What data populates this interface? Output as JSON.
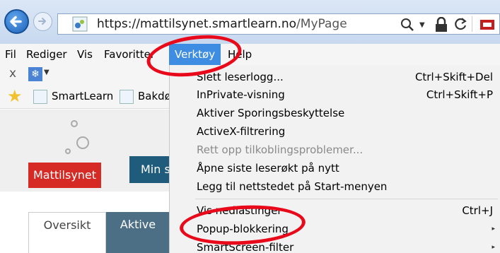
{
  "browser": {
    "url_scheme": "https://",
    "url_host": "mattilsynet.smartlearn.no",
    "url_path": "/MyPage"
  },
  "menubar": {
    "items": [
      "Fil",
      "Rediger",
      "Vis",
      "Favoritter",
      "Verktøy",
      "Help"
    ],
    "active": "Verktøy"
  },
  "favorites": {
    "items": [
      "SmartLearn",
      "Bakdø"
    ]
  },
  "page": {
    "logo_text": "Mattilsynet",
    "button_label": "Min s",
    "tabs": [
      "Oversikt",
      "Aktive"
    ]
  },
  "tools_menu": {
    "items": [
      {
        "label": "Slett leserlogg...",
        "shortcut": "Ctrl+Skift+Del"
      },
      {
        "label": "InPrivate-visning",
        "shortcut": "Ctrl+Skift+P"
      },
      {
        "label": "Aktiver Sporingsbeskyttelse",
        "shortcut": ""
      },
      {
        "label": "ActiveX-filtrering",
        "shortcut": ""
      },
      {
        "label": "Rett opp tilkoblingsproblemer...",
        "shortcut": "",
        "disabled": true
      },
      {
        "label": "Åpne siste leserøkt på nytt",
        "shortcut": ""
      },
      {
        "label": "Legg til nettstedet på Start-menyen",
        "shortcut": ""
      },
      {
        "label": "Vis nedlastinger",
        "shortcut": "Ctrl+J"
      },
      {
        "label": "Popup-blokkering",
        "shortcut": "",
        "submenu": true
      },
      {
        "label": "SmartScreen-filter",
        "shortcut": "",
        "submenu": true
      }
    ]
  },
  "colors": {
    "menu_highlight": "#3e8de3",
    "annotation_red": "#e8091a",
    "logo_red": "#d52b24"
  }
}
